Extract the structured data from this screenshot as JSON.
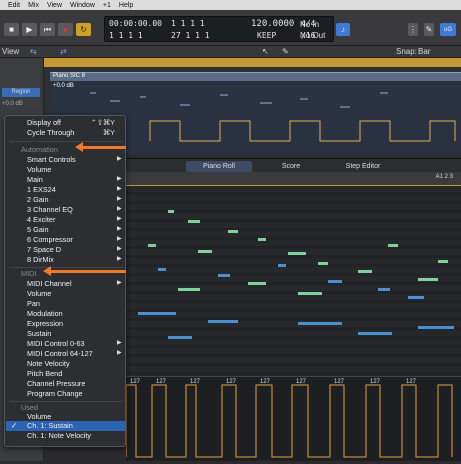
{
  "menubar": {
    "items": [
      "Edit",
      "Mix",
      "View",
      "Window",
      "+1",
      "Help"
    ]
  },
  "lcd": {
    "time": "00:00:00.00",
    "bars": "1  1  1  1",
    "smpte": "1  1  1  1",
    "pos2": "27  1  1  1",
    "tempo": "120.0000",
    "keep": "KEEP",
    "sig": "4/4",
    "div": "/16",
    "in": "No In",
    "out": "No Out"
  },
  "toolbar": {
    "view_label": "View",
    "snap_label": "Snap:",
    "snap_value": "Bar"
  },
  "inspector": {
    "region_label": "Region",
    "vol_label": "+0.0 dB"
  },
  "region": {
    "name": "Piano SIC 8",
    "vol": "+0.0 dB"
  },
  "editor": {
    "tabs": [
      "Piano Roll",
      "Score",
      "Step Editor"
    ],
    "region_label": "A1 2 3"
  },
  "lane_values": [
    "127",
    "127",
    "127",
    "127",
    "127",
    "127",
    "127",
    "127",
    "127"
  ],
  "menu": {
    "items_top": [
      {
        "label": "Display off",
        "shortcut": "⌃⇧⌘Y"
      },
      {
        "label": "Cycle Through",
        "shortcut": "⌘Y"
      }
    ],
    "automation_header": "Automation",
    "automation": [
      "Smart Controls",
      "Volume",
      "Main",
      "1 EXS24",
      "2 Gain",
      "3 Channel EQ",
      "4 Exciter",
      "5 Gain",
      "6 Compressor",
      "7 Space D",
      "8 DirMix"
    ],
    "midi_header": "MIDI",
    "midi": [
      "MIDI Channel",
      "Volume",
      "Pan",
      "Modulation",
      "Expression",
      "Sustain",
      "MIDI Control 0-63",
      "MIDI Control 64-127",
      "Note Velocity",
      "Pitch Bend",
      "Channel Pressure",
      "Program Change"
    ],
    "used_header": "Used",
    "used": [
      "Volume",
      "Ch. 1: Sustain",
      "Ch. 1: Note Velocity"
    ],
    "checkmark": "✓"
  },
  "colors": {
    "accent": "#2d63b3",
    "annotation": "#f07a2a",
    "ruler": "#c59a35"
  }
}
